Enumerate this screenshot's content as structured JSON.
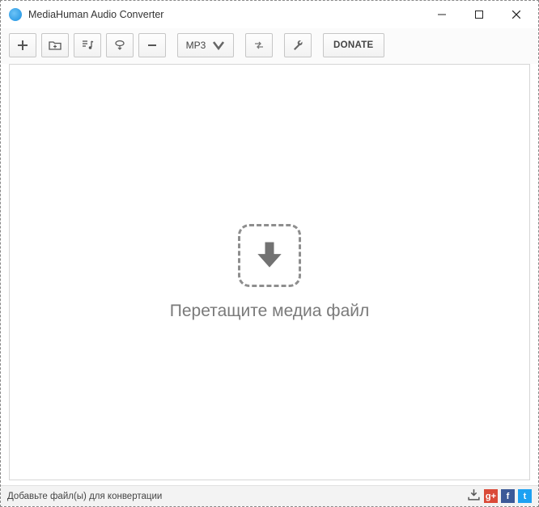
{
  "titlebar": {
    "title": "MediaHuman Audio Converter"
  },
  "toolbar": {
    "format_label": "MP3",
    "donate_label": "DONATE"
  },
  "content": {
    "drop_text": "Перетащите медиа файл"
  },
  "statusbar": {
    "text": "Добавьте файл(ы) для конвертации"
  },
  "social": {
    "gp": "g+",
    "fb": "f",
    "tw": "t"
  }
}
